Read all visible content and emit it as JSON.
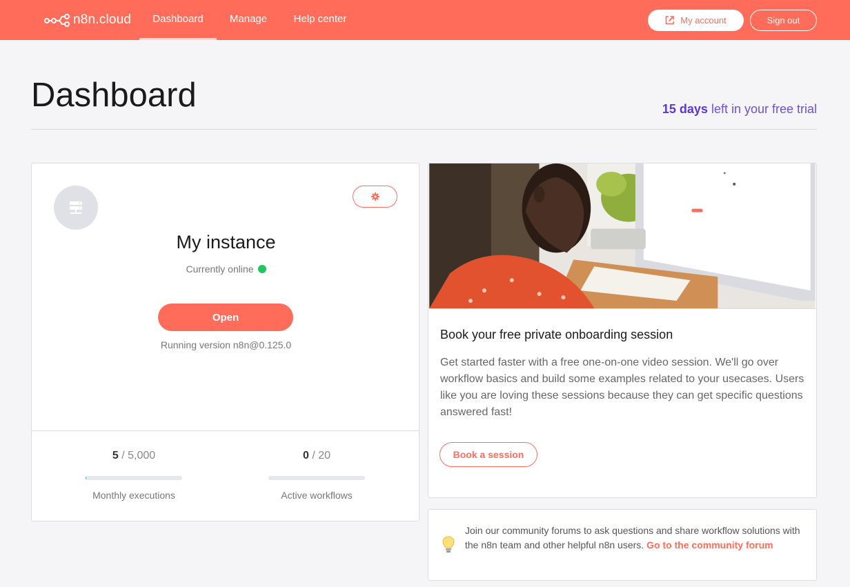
{
  "header": {
    "logo_text": "n8n.cloud",
    "nav": [
      {
        "label": "Dashboard",
        "active": true
      },
      {
        "label": "Manage",
        "active": false
      },
      {
        "label": "Help center",
        "active": false
      }
    ],
    "my_account_label": "My account",
    "sign_out_label": "Sign out"
  },
  "page": {
    "title": "Dashboard",
    "trial_days": "15 days",
    "trial_suffix": " left in your free trial"
  },
  "instance": {
    "name": "My instance",
    "status": "Currently online",
    "open_label": "Open",
    "version": "Running version n8n@0.125.0",
    "stats": [
      {
        "used": "5",
        "limit": " / 5,000",
        "label": "Monthly executions",
        "fraction": 0.001
      },
      {
        "used": "0",
        "limit": " / 20",
        "label": "Active workflows",
        "fraction": 0
      }
    ]
  },
  "onboarding": {
    "title": "Book your free private onboarding session",
    "body": "Get started faster with a free one-on-one video session. We'll go over workflow basics and build some examples related to your usecases. Users like you are loving these sessions because they can get specific questions answered fast!",
    "button_label": "Book a session"
  },
  "community": {
    "text": "Join our community forums to ask questions and share workflow solutions with the n8n team and other helpful n8n users. ",
    "link_label": "Go to the community forum"
  },
  "colors": {
    "brand": "#ff6d5a",
    "trial_accent": "#5a38d8",
    "online": "#22c55e"
  },
  "icons": [
    "n8n-logo-icon",
    "external-link-icon",
    "server-icon",
    "gear-icon",
    "lightbulb-icon"
  ]
}
